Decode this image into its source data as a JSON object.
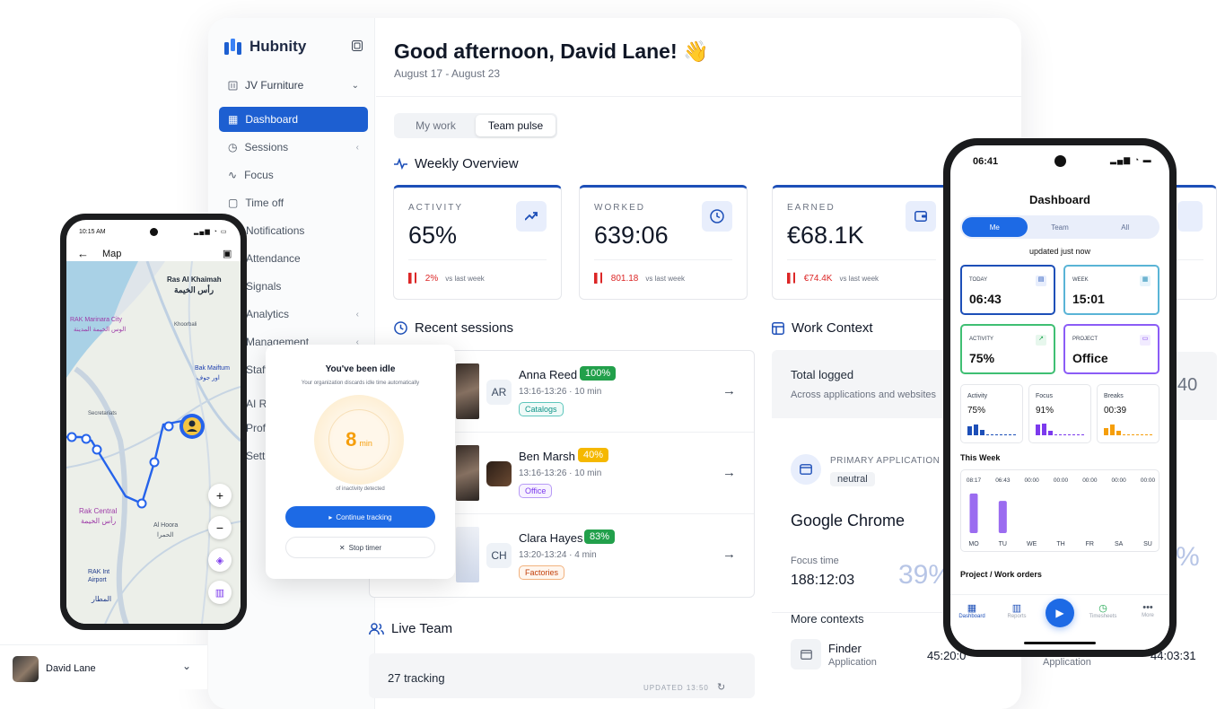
{
  "app": {
    "name": "Hubnity"
  },
  "sidebar": {
    "workspace": "JV Furniture",
    "items": [
      {
        "label": "Dashboard"
      },
      {
        "label": "Sessions"
      },
      {
        "label": "Focus"
      },
      {
        "label": "Time off"
      },
      {
        "label": "Notifications"
      },
      {
        "label": "Attendance"
      },
      {
        "label": "Signals"
      },
      {
        "label": "Analytics"
      },
      {
        "label": "Management"
      },
      {
        "label": "Staff"
      },
      {
        "label": "AI Re"
      },
      {
        "label": "Profi"
      },
      {
        "label": "Setti"
      }
    ],
    "user": "David Lane"
  },
  "header": {
    "greeting": "Good afternoon, David Lane! 👋",
    "range": "August 17 - August 23"
  },
  "tabs": [
    "My work",
    "Team pulse"
  ],
  "weekly": {
    "title": "Weekly Overview",
    "stats": [
      {
        "label": "ACTIVITY",
        "value": "65%",
        "change": "2%",
        "vs": "vs last week"
      },
      {
        "label": "WORKED",
        "value": "639:06",
        "change": "801.18",
        "vs": "vs last week"
      },
      {
        "label": "EARNED",
        "value": "€68.1K",
        "change": "€74.4K",
        "vs": "vs last week"
      }
    ]
  },
  "recent": {
    "title": "Recent sessions",
    "rows": [
      {
        "initials": "AR",
        "name": "Anna Reed",
        "pct": "100%",
        "time": "13:16-13:26 · 10 min",
        "tag": "Catalogs"
      },
      {
        "initials": "",
        "name": "Ben Marsh",
        "pct": "40%",
        "time": "13:16-13:26 · 10 min",
        "tag": "Office"
      },
      {
        "initials": "CH",
        "name": "Clara Hayes",
        "pct": "83%",
        "time": "13:20-13:24 · 4 min",
        "tag": "Factories"
      }
    ]
  },
  "context": {
    "title": "Work Context",
    "total_label": "Total logged",
    "total_sub": "Across applications and websites",
    "total_value": "40",
    "primary_label": "PRIMARY APPLICATION",
    "primary_badge": "neutral",
    "primary_app": "Google Chrome",
    "focus_label": "Focus time",
    "focus_value": "188:12:03",
    "focus_pct": "39%",
    "focus_pct2": "%",
    "more_title": "More contexts",
    "more": [
      {
        "name": "Finder",
        "sub": "Application",
        "time": "45:20:0"
      },
      {
        "name": "",
        "sub": "Application",
        "time": "44:03:31"
      }
    ]
  },
  "live": {
    "title": "Live Team",
    "tracking": "27 tracking",
    "updated": "UPDATED 13:50"
  },
  "idle": {
    "title": "You've been idle",
    "subtitle": "Your organization discards idle time automatically",
    "minutes": "8",
    "unit": "min",
    "detected": "of inactivity detected",
    "continue": "Continue tracking",
    "stop": "Stop timer"
  },
  "map_phone": {
    "time": "10:15 AM",
    "title": "Map",
    "places": [
      {
        "en": "Ras Al Khaimah",
        "ar": "رأس الخيمة"
      },
      {
        "en": "RAK Marinara City",
        "ar": "الوس الخيمة المدينة"
      },
      {
        "en": "Khoorbali",
        "ar": ""
      },
      {
        "en": "Bak Maiftum",
        "ar": "اور جوف"
      },
      {
        "en": "Secretariats",
        "ar": ""
      },
      {
        "en": "Rak Central",
        "ar": "رأس الخيمة"
      },
      {
        "en": "Al Hoora",
        "ar": "الحمرا"
      },
      {
        "en": "RAK Int Airport",
        "ar": "المطار"
      }
    ]
  },
  "mobile": {
    "time": "06:41",
    "title": "Dashboard",
    "segments": [
      "Me",
      "Team",
      "All"
    ],
    "updated": "updated just now",
    "cards": [
      {
        "label": "TODAY",
        "value": "06:43"
      },
      {
        "label": "WEEK",
        "value": "15:01"
      },
      {
        "label": "ACTIVITY",
        "value": "75%"
      },
      {
        "label": "PROJECT",
        "value": "Office"
      }
    ],
    "minis": [
      {
        "label": "Activity",
        "value": "75%"
      },
      {
        "label": "Focus",
        "value": "91%"
      },
      {
        "label": "Breaks",
        "value": "00:39"
      }
    ],
    "week_title": "This Week",
    "week_values": [
      "08:17",
      "06:43",
      "00:00",
      "00:00",
      "00:00",
      "00:00",
      "00:00"
    ],
    "week_days": [
      "MO",
      "TU",
      "WE",
      "TH",
      "FR",
      "SA",
      "SU"
    ],
    "project_title": "Project / Work orders",
    "nav": [
      "Dashboard",
      "Reports",
      "Timesheets",
      "More"
    ]
  },
  "chart_data": {
    "type": "bar",
    "categories": [
      "MO",
      "TU",
      "WE",
      "TH",
      "FR",
      "SA",
      "SU"
    ],
    "values": [
      8.28,
      6.72,
      0,
      0,
      0,
      0,
      0
    ],
    "title": "This Week"
  },
  "colors": {
    "primary": "#1d5fd1",
    "accent": "#1d4fb8",
    "danger": "#dc2626",
    "green": "#16a34a",
    "amber": "#f59e0b",
    "purple": "#8b5cf6"
  }
}
